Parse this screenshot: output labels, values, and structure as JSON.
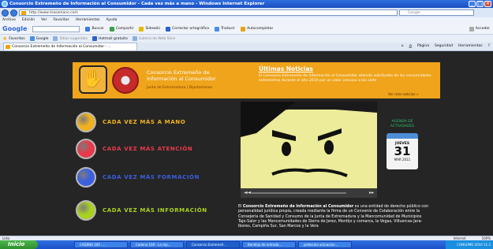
{
  "window": {
    "title": "Consorcio Extremeño de Información al Consumidor - Cada vez más a mano - Windows Internet Explorer"
  },
  "address": {
    "url": "http://www.masamano.com",
    "search_placeholder": "Google"
  },
  "menu": [
    "Archivo",
    "Edición",
    "Ver",
    "Favoritos",
    "Herramientas",
    "Ayuda"
  ],
  "googlebar": {
    "logo": "Google",
    "buscar": "Buscar",
    "compartir": "Compartir",
    "sidewiki": "Sidewiki",
    "corrector": "Corrector ortográfico",
    "traducir": "Traducir",
    "autocompletar": "Autocompletar",
    "acceder": "Acceder"
  },
  "favbar": {
    "favoritos": "Favoritos",
    "google": "Google",
    "sitios": "Sitios sugeridos",
    "hotmail": "Hotmail gratuito",
    "galeria": "Galería de Web Slice"
  },
  "tab": {
    "label": "Consorcio Extremeño de Información al Consumidor - ..."
  },
  "pagecmds": [
    "Página",
    "Seguridad",
    "Herramientas"
  ],
  "site": {
    "org_name": "Consorcio Extremeño de Información al Consumidor",
    "org_sub": "Junta de Extremadura | Diputaciones",
    "news_title": "Últimas Noticias",
    "news_text": "El Consorcio Extremeño de Información al Consumidor atiende solicitudes de los consumidores extremeños durante el año 2010 por un valor cercano a los siete",
    "news_more": "Ver más noticias »",
    "nav": [
      {
        "label": "CADA VEZ MÁS A MANO",
        "color": "#f2b21e"
      },
      {
        "label": "CADA VEZ MÁS ATENCIÓN",
        "color": "#e83a4a"
      },
      {
        "label": "CADA VEZ MÁS FORMACIÓN",
        "color": "#3a5fe0"
      },
      {
        "label": "CADA VEZ MÁS INFORMACIÓN",
        "color": "#a8d21e"
      }
    ],
    "agenda_title": "AGENDA DE ACTIVIDADES",
    "calendar": {
      "day": "JUEVES",
      "number": "31",
      "month": "MAR 2011"
    },
    "about_bold": "Consorcio Extremeño de Información al Consumidor",
    "about_pre": "El",
    "about_text": "es una entidad de derecho público con personalidad jurídica propia, creada mediante la firma de un Convenio de Colaboración entre la Consejería de Sanidad y Consumo de la Junta de Extremadura y la Mancomunidad de Municipios Tajo-Salor y las Mancomunidades de Sierra de Jerez, Montijo y comarca, la Vegas, Villuercas-Jara-Ibores, Campiña Sur, San Marcos y la Vera"
  },
  "status": {
    "left": "Listo",
    "zone": "Internet",
    "zoom": "100%"
  },
  "taskbar": {
    "start": "Inicio",
    "tasks": [
      "CADENA 100 -...",
      "Cadena 100 - La rep...",
      "Consorcio Extremeñ...",
      "Bandeja de entrada...",
      "protocolo actuacion..."
    ],
    "tray": "CONSUMO 2010  11:2"
  }
}
